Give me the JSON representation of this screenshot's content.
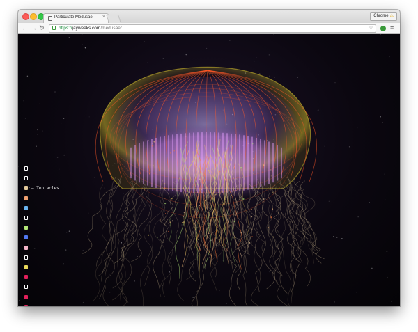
{
  "browser": {
    "tab_title": "Particulate Medusae",
    "tab_close": "×",
    "profile_label": "Chrome",
    "url_scheme": "https://",
    "url_host": "jayweeks.com",
    "url_path": "/medusae/",
    "icons": [
      "back-arrow-icon",
      "forward-arrow-icon",
      "reload-icon",
      "lock-icon",
      "star-icon",
      "extension-icon",
      "menu-icon"
    ]
  },
  "gui": {
    "label_prefix": "— ",
    "controls": [
      {
        "label": "",
        "color": "#ffffff",
        "filled": false
      },
      {
        "label": "",
        "color": "#ffffff",
        "filled": false
      },
      {
        "label": "Tentacles",
        "color": "#e2c99a",
        "filled": true
      },
      {
        "label": "",
        "color": "#f0a070",
        "filled": true
      },
      {
        "label": "",
        "color": "#6ab4f0",
        "filled": true
      },
      {
        "label": "",
        "color": "#ffffff",
        "filled": false
      },
      {
        "label": "",
        "color": "#b4e678",
        "filled": true
      },
      {
        "label": "",
        "color": "#5078f0",
        "filled": true
      },
      {
        "label": "",
        "color": "#f4b4c8",
        "filled": true
      },
      {
        "label": "",
        "color": "#ffffff",
        "filled": false
      },
      {
        "label": "",
        "color": "#e8d85a",
        "filled": true
      },
      {
        "label": "",
        "color": "#e0205a",
        "filled": true
      },
      {
        "label": "",
        "color": "#ffffff",
        "filled": false
      },
      {
        "label": "",
        "color": "#e0205a",
        "filled": true
      },
      {
        "label": "",
        "color": "#e0205a",
        "filled": true
      }
    ]
  },
  "scene": {
    "subject": "jellyfish",
    "colors": {
      "background": "#0b0710",
      "bell_outer": "#c8b428",
      "bell_ribs": "#ff5a28",
      "inner_glow": "#e6a0ff",
      "tentacles": "#c8b48c",
      "particles": "#ffffff"
    }
  }
}
